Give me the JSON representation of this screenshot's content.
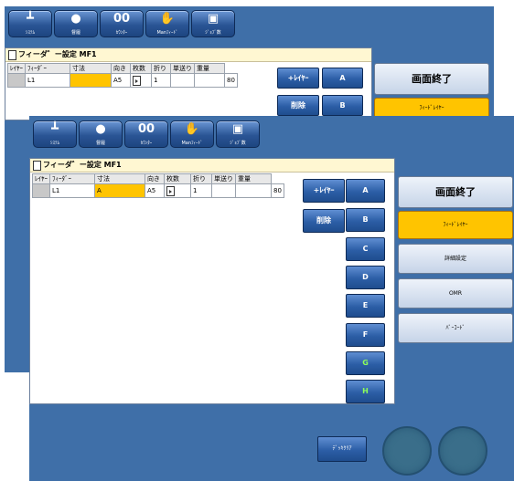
{
  "toolbar": [
    {
      "glyph": "┻",
      "label": "ｼｽﾃﾑ"
    },
    {
      "glyph": "●",
      "label": "督履"
    },
    {
      "glyph": "00",
      "label": "ｶｳﾝﾀｰ"
    },
    {
      "glyph": "✋",
      "label": "Manﾌｨｰﾄﾞ"
    },
    {
      "glyph": "▣",
      "label": "ｼﾞｮﾌﾞ数"
    }
  ],
  "window": {
    "title": "フィーダ゛ー設定 MF1",
    "headers": [
      "ﾚｲﾔｰ",
      "ﾌｨｰﾀﾞｰ",
      "寸法",
      "向き",
      "枚数",
      "折り",
      "単送り",
      "重量"
    ]
  },
  "back": {
    "row": {
      "layer": "L1",
      "feeder": "",
      "size": "A5",
      "count": "1",
      "weight": "80"
    }
  },
  "front": {
    "row": {
      "layer": "L1",
      "feeder": "A",
      "size": "A5",
      "count": "1",
      "weight": "80"
    }
  },
  "buttons": {
    "add_layer": "+ﾚｲﾔｰ",
    "delete": "削除"
  },
  "feeder_buttons": [
    "A",
    "B",
    "C",
    "D",
    "E",
    "F",
    "G",
    "H"
  ],
  "right_panel": {
    "end": "画面終了",
    "feed_layer": "ﾌｨｰﾄﾞﾚｲﾔｰ",
    "detail": "詳細設定",
    "omr": "OMR",
    "barcode": "ﾊﾞｰｺｰﾄﾞ"
  },
  "deck_clear": "ﾃﾞｯｷｸﾘｱ",
  "colors": {
    "background": "#3f6fa8",
    "selected": "#ffc400",
    "feeder_green": "#8cff5a"
  }
}
